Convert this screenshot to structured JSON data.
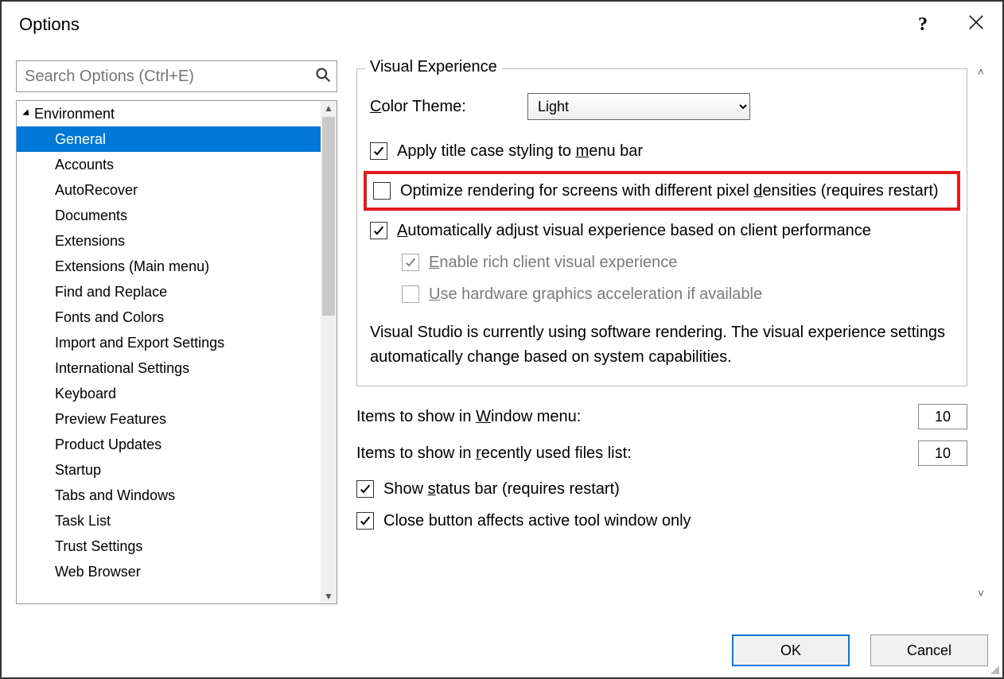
{
  "window": {
    "title": "Options"
  },
  "search": {
    "placeholder": "Search Options (Ctrl+E)"
  },
  "tree": {
    "parent": "Environment",
    "items": [
      "General",
      "Accounts",
      "AutoRecover",
      "Documents",
      "Extensions",
      "Extensions (Main menu)",
      "Find and Replace",
      "Fonts and Colors",
      "Import and Export Settings",
      "International Settings",
      "Keyboard",
      "Preview Features",
      "Product Updates",
      "Startup",
      "Tabs and Windows",
      "Task List",
      "Trust Settings",
      "Web Browser"
    ],
    "selected": "General"
  },
  "group": {
    "title": "Visual Experience",
    "color_theme_label": "Color Theme:",
    "color_theme_value": "Light",
    "apply_title_case": "Apply title case styling to menu bar",
    "optimize_rendering": "Optimize rendering for screens with different pixel densities (requires restart)",
    "auto_adjust": "Automatically adjust visual experience based on client performance",
    "enable_rich": "Enable rich client visual experience",
    "use_hardware": "Use hardware graphics acceleration if available",
    "note": "Visual Studio is currently using software rendering.  The visual experience settings automatically change based on system capabilities."
  },
  "lower": {
    "window_menu_label": "Items to show in Window menu:",
    "window_menu_value": "10",
    "recent_files_label": "Items to show in recently used files list:",
    "recent_files_value": "10",
    "show_status_bar": "Show status bar (requires restart)",
    "close_button_affects": "Close button affects active tool window only"
  },
  "footer": {
    "ok": "OK",
    "cancel": "Cancel"
  }
}
